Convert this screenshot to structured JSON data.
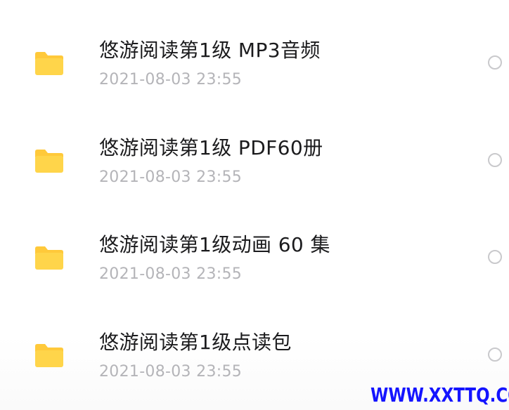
{
  "files": [
    {
      "name": "悠游阅读第1级 MP3音频",
      "date": "2021-08-03 23:55",
      "icon": "folder-icon"
    },
    {
      "name": "悠游阅读第1级 PDF60册",
      "date": "2021-08-03 23:55",
      "icon": "folder-icon"
    },
    {
      "name": "悠游阅读第1级动画 60 集",
      "date": "2021-08-03 23:55",
      "icon": "folder-icon"
    },
    {
      "name": "悠游阅读第1级点读包",
      "date": "2021-08-03 23:55",
      "icon": "folder-icon"
    }
  ],
  "watermark": {
    "text": "WWW.XXTTQ.COM",
    "color": "#1414ff"
  },
  "colors": {
    "folder_body": "#ffd54a",
    "folder_tab": "#ffc93a",
    "title_text": "#1b1b1d",
    "date_text": "#b4b4b8",
    "radio_border": "#c9c9cc"
  }
}
